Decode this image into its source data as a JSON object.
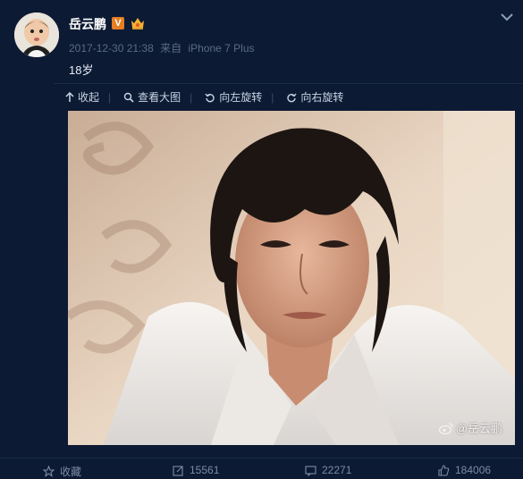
{
  "post": {
    "username": "岳云鹏",
    "verified_badge": "V",
    "timestamp": "2017-12-30 21:38",
    "source_prefix": "来自",
    "source": "iPhone 7 Plus",
    "text": "18岁"
  },
  "toolbar": {
    "collapse_label": "收起",
    "view_large_label": "查看大图",
    "rotate_left_label": "向左旋转",
    "rotate_right_label": "向右旋转"
  },
  "image": {
    "watermark": "@岳云鹏"
  },
  "actions": {
    "favorite_label": "收藏",
    "repost_count": "15561",
    "comment_count": "22271",
    "like_count": "184006"
  },
  "colors": {
    "background": "#0c1a33",
    "meta_text": "#5b6b87",
    "badge": "#e67e22"
  },
  "icons": [
    "collapse-icon",
    "magnifier-icon",
    "rotate-left-icon",
    "rotate-right-icon",
    "star-icon",
    "repost-icon",
    "comment-icon",
    "thumbs-up-icon",
    "chevron-down-icon",
    "weibo-logo-icon"
  ]
}
